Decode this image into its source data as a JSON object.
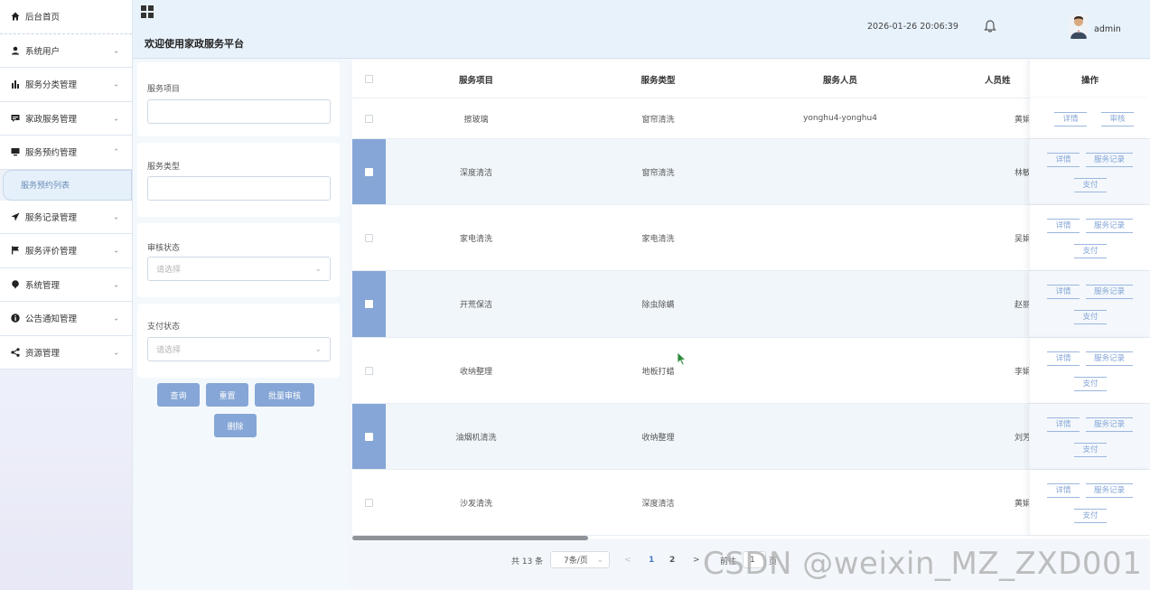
{
  "sidebar": {
    "items": [
      {
        "label": "后台首页",
        "icon": "home-icon"
      },
      {
        "label": "系统用户",
        "icon": "user-icon"
      },
      {
        "label": "服务分类管理",
        "icon": "bar-chart-icon"
      },
      {
        "label": "家政服务管理",
        "icon": "comment-icon"
      },
      {
        "label": "服务预约管理",
        "icon": "monitor-icon"
      },
      {
        "label": "服务记录管理",
        "icon": "send-icon"
      },
      {
        "label": "服务评价管理",
        "icon": "flag-icon"
      },
      {
        "label": "系统管理",
        "icon": "pin-icon"
      },
      {
        "label": "公告通知管理",
        "icon": "info-icon"
      },
      {
        "label": "资源管理",
        "icon": "share-icon"
      }
    ],
    "sub_item": "服务预约列表"
  },
  "header": {
    "welcome": "欢迎使用家政服务平台",
    "datetime": "2026-01-26 20:06:39",
    "username": "admin"
  },
  "search": {
    "service_item_label": "服务项目",
    "service_type_label": "服务类型",
    "audit_status_label": "审核状态",
    "audit_status_placeholder": "请选择",
    "pay_status_label": "支付状态",
    "pay_status_placeholder": "请选择",
    "query_btn": "查询",
    "reset_btn": "重置",
    "batch_audit_btn": "批量审核",
    "delete_btn": "删除"
  },
  "table": {
    "headers": [
      "服务项目",
      "服务类型",
      "服务人员",
      "人员姓",
      "操作"
    ],
    "rows": [
      {
        "item": "擦玻璃",
        "type": "窗帘清洗",
        "staff": "yonghu4-yonghu4",
        "name": "黄娟",
        "ops": [
          "详情",
          "审核"
        ],
        "selected": false
      },
      {
        "item": "深度清洁",
        "type": "窗帘清洗",
        "staff": "",
        "name": "林敏",
        "ops": [
          "详情",
          "服务记录",
          "支付"
        ],
        "selected": true
      },
      {
        "item": "家电清洗",
        "type": "家电清洗",
        "staff": "",
        "name": "吴娟",
        "ops": [
          "详情",
          "服务记录",
          "支付"
        ],
        "selected": false
      },
      {
        "item": "开荒保洁",
        "type": "除虫除螨",
        "staff": "",
        "name": "赵丽",
        "ops": [
          "详情",
          "服务记录",
          "支付"
        ],
        "selected": true
      },
      {
        "item": "收纳整理",
        "type": "地板打蜡",
        "staff": "",
        "name": "李娟",
        "ops": [
          "详情",
          "服务记录",
          "支付"
        ],
        "selected": false
      },
      {
        "item": "油烟机清洗",
        "type": "收纳整理",
        "staff": "",
        "name": "刘芳",
        "ops": [
          "详情",
          "服务记录",
          "支付"
        ],
        "selected": true
      },
      {
        "item": "沙发清洗",
        "type": "深度清洁",
        "staff": "",
        "name": "黄娟",
        "ops": [
          "详情",
          "服务记录",
          "支付"
        ],
        "selected": false
      }
    ]
  },
  "pagination": {
    "total": "共 13 条",
    "page_size": "7条/页",
    "pages": [
      "1",
      "2"
    ],
    "goto_prefix": "前往",
    "goto_value": "1",
    "goto_suffix": "页"
  },
  "watermark": "CSDN @weixin_MZ_ZXD001",
  "colors": {
    "accent": "#85a6d6",
    "header_bg": "#e8f2fb",
    "selected_row": "#f1f6fb"
  }
}
